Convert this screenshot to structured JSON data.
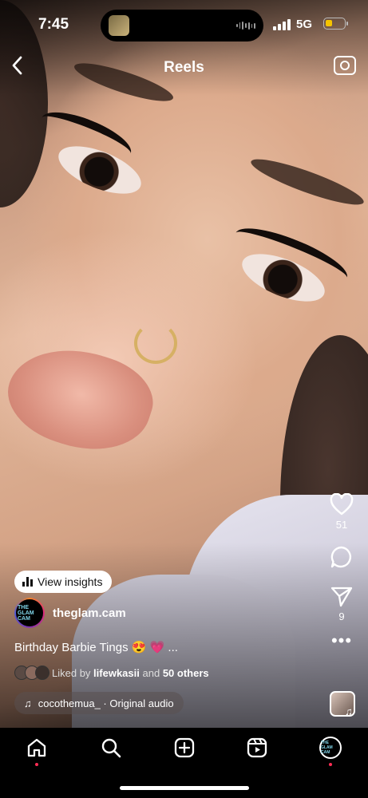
{
  "status_bar": {
    "time": "7:45",
    "network": "5G",
    "battery_level": 0.35,
    "battery_color": "#f5c400",
    "island_icons": [
      "music-album-thumbnail",
      "audio-waveform-icon"
    ]
  },
  "header": {
    "title": "Reels",
    "back_icon": "chevron-left-icon",
    "camera_icon": "camera-icon"
  },
  "actions": {
    "like_count": "51",
    "share_count": "9",
    "icons": [
      "heart-icon",
      "comment-icon",
      "send-icon",
      "more-icon"
    ]
  },
  "post": {
    "insights_label": "View insights",
    "username": "theglam.cam",
    "avatar_text": "THE GLAM CAM",
    "caption": "Birthday Barbie Tings 😍 💗  ...",
    "liked_prefix": "Liked by",
    "liked_user": "lifewkasii",
    "liked_and": "and",
    "liked_others": "50 others",
    "audio": "cocothemua_ · Original audio"
  },
  "bottom_nav": {
    "items": [
      "home-icon",
      "search-icon",
      "create-icon",
      "reels-icon",
      "profile-avatar"
    ],
    "accent": "#ff2d55"
  }
}
